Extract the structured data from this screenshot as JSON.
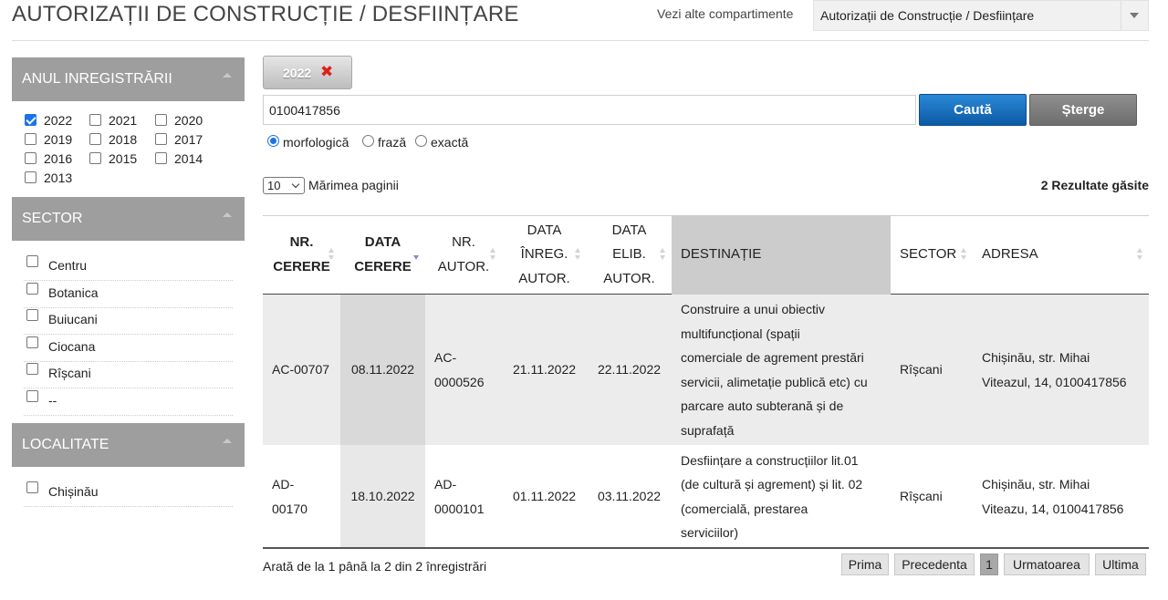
{
  "header": {
    "title": "AUTORIZAȚII DE CONSTRUCȚIE / DESFIINȚARE",
    "compartments_label": "Vezi alte compartimente",
    "compartment_selected": "Autorizații de Construcție / Desființare"
  },
  "sidebar": {
    "year_panel": {
      "title": "ANUL INREGISTRĂRII",
      "years": [
        {
          "label": "2022",
          "checked": true
        },
        {
          "label": "2021",
          "checked": false
        },
        {
          "label": "2020",
          "checked": false
        },
        {
          "label": "2019",
          "checked": false
        },
        {
          "label": "2018",
          "checked": false
        },
        {
          "label": "2017",
          "checked": false
        },
        {
          "label": "2016",
          "checked": false
        },
        {
          "label": "2015",
          "checked": false
        },
        {
          "label": "2014",
          "checked": false
        },
        {
          "label": "2013",
          "checked": false
        }
      ]
    },
    "sector_panel": {
      "title": "SECTOR",
      "items": [
        {
          "label": "Centru",
          "checked": false
        },
        {
          "label": "Botanica",
          "checked": false
        },
        {
          "label": "Buiucani",
          "checked": false
        },
        {
          "label": "Ciocana",
          "checked": false
        },
        {
          "label": "Rîșcani",
          "checked": false
        },
        {
          "label": "--",
          "checked": false
        }
      ]
    },
    "locality_panel": {
      "title": "LOCALITATE",
      "items": [
        {
          "label": "Chișinău",
          "checked": false
        }
      ]
    }
  },
  "filters": {
    "active_tag": "2022",
    "active_tag_remove": "✖"
  },
  "search": {
    "value": "0100417856",
    "search_label": "Caută",
    "clear_label": "Șterge",
    "modes": [
      {
        "label": "morfologică",
        "selected": true
      },
      {
        "label": "frază",
        "selected": false
      },
      {
        "label": "exactă",
        "selected": false
      }
    ]
  },
  "paging": {
    "page_size": "10",
    "page_size_label": "Mărimea paginii",
    "results_count": "2 Rezultate găsite",
    "info": "Arată de la 1 până la 2 din 2 înregistrări",
    "buttons": {
      "first": "Prima",
      "prev": "Precedenta",
      "current": "1",
      "next": "Urmatoarea",
      "last": "Ultima"
    }
  },
  "table": {
    "columns": [
      {
        "lines": [
          "NR.",
          "CERERE"
        ],
        "bold": true,
        "sort": "none"
      },
      {
        "lines": [
          "DATA",
          "CERERE"
        ],
        "bold": true,
        "sort": "desc"
      },
      {
        "lines": [
          "NR.",
          "AUTOR."
        ],
        "bold": false,
        "sort": "none"
      },
      {
        "lines": [
          "DATA",
          "ÎNREG.",
          "AUTOR."
        ],
        "bold": false,
        "sort": "none"
      },
      {
        "lines": [
          "DATA",
          "ELIB.",
          "AUTOR."
        ],
        "bold": false,
        "sort": "none"
      },
      {
        "lines": [
          "DESTINAȚIE"
        ],
        "bold": false,
        "sort": "none"
      },
      {
        "lines": [
          "SECTOR"
        ],
        "bold": false,
        "sort": "none"
      },
      {
        "lines": [
          "ADRESA"
        ],
        "bold": false,
        "sort": "none"
      }
    ],
    "rows": [
      {
        "cells": [
          [
            "AC-00707"
          ],
          [
            "08.11.2022"
          ],
          [
            "AC-",
            "0000526"
          ],
          [
            "21.11.2022"
          ],
          [
            "22.11.2022"
          ],
          [
            "Construire a unui obiectiv",
            "multifuncțional (spații",
            "comerciale de agrement prestări",
            "servicii, alimetație publică etc) cu",
            "parcare auto subterană și de",
            "suprafață"
          ],
          [
            "Rîșcani"
          ],
          [
            "Chișinău, str. Mihai",
            "Viteazul, 14, 0100417856"
          ]
        ]
      },
      {
        "cells": [
          [
            "AD-",
            "00170"
          ],
          [
            "18.10.2022"
          ],
          [
            "AD-",
            "0000101"
          ],
          [
            "01.11.2022"
          ],
          [
            "03.11.2022"
          ],
          [
            "Desființare a construcțiilor lit.01",
            "(de cultură și agrement) și lit. 02",
            "(comercială, prestarea",
            "serviciilor)"
          ],
          [
            "Rîșcani"
          ],
          [
            "Chișinău, str. Mihai",
            "Viteazu, 14, 0100417856"
          ]
        ]
      }
    ]
  }
}
